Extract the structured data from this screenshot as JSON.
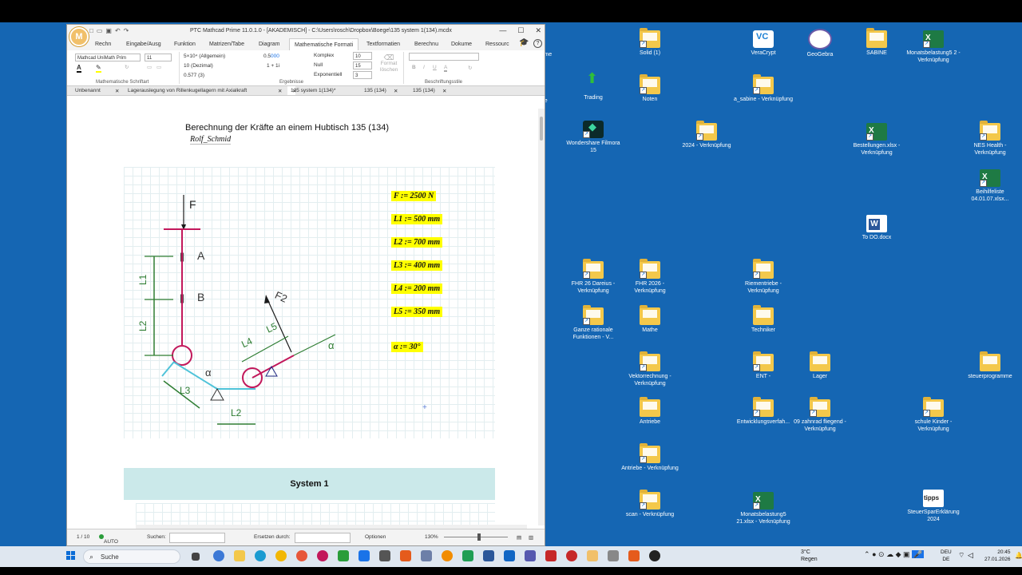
{
  "window": {
    "title": "PTC Mathcad Prime 11.0.1.0 - [AKADEMISCH] - C:\\Users\\rosch\\Dropbox\\Boege\\135 system 1(134).mcdx",
    "logo_letter": "M",
    "minimize": "—",
    "maximize": "☐",
    "close": "✕",
    "help": "?"
  },
  "ribbon_tabs": [
    {
      "label": "Rechn"
    },
    {
      "label": "Eingabe/Ausg"
    },
    {
      "label": "Funktion"
    },
    {
      "label": "Matrizen/Tabe"
    },
    {
      "label": "Diagram"
    },
    {
      "label": "Mathematische Formati"
    },
    {
      "label": "Textformatien"
    },
    {
      "label": "Berechnu"
    },
    {
      "label": "Dokume"
    },
    {
      "label": "Ressourc"
    }
  ],
  "ribbon": {
    "font": "Mathcad UniMath Prim",
    "font_size": "11",
    "format_general": "5×10⁴ (Allgemein)",
    "format_decimal": "10 (Dezimal)",
    "format_third": "0.577 (3)",
    "value_a_black": "0.5",
    "value_a_blue": "000",
    "value_b": "1 + 1i",
    "complex_label": "Komplex",
    "complex_value": "10",
    "null_label": "Null",
    "null_value": "15",
    "exp_label": "Exponentiell",
    "exp_value": "3",
    "format_clear": "Format löschen",
    "style_box": "",
    "group_font": "Mathematische Schriftart",
    "group_results": "Ergebnisse",
    "group_labels": "Beschriftungsstile"
  },
  "doc_tabs": [
    {
      "label": "Unbenannt"
    },
    {
      "label": "Lagerauslegung von Rillenkugellagern mit Axialkraft"
    },
    {
      "label": "135 system 1(134)*"
    },
    {
      "label": "135 (134)"
    },
    {
      "label": "135 (134)"
    }
  ],
  "worksheet": {
    "heading": "Berechnung der Kräfte an einem Hubtisch   135 (134)",
    "author": "Rolf_Schmid",
    "definitions": [
      {
        "label": "F := 2500 N"
      },
      {
        "label": "L1 := 500 mm"
      },
      {
        "label": "L2 := 700 mm"
      },
      {
        "label": "L3 := 400 mm"
      },
      {
        "label": "L4 := 200 mm"
      },
      {
        "label": "L5 := 350 mm"
      },
      {
        "label": "α := 30°"
      }
    ],
    "section_title": "System 1"
  },
  "sketch": {
    "labels": {
      "F": "F",
      "A": "A",
      "B": "B",
      "F2": "F2",
      "L1": "L1",
      "L2": "L2",
      "L3": "L3",
      "L4": "L4",
      "L5": "L5",
      "alpha": "α",
      "L2b": "L2"
    },
    "colors": {
      "force": "#1a1a1a",
      "member": "#c2185b",
      "link": "#4fc3d9",
      "dimension": "#2e7d32"
    }
  },
  "status": {
    "page": "1 / 10",
    "mode": "AUTO",
    "search_label": "Suchen:",
    "replace_label": "Ersetzen durch:",
    "options": "Optionen",
    "zoom": "130%"
  },
  "desktop_icons": [
    {
      "label": "Solid (1)",
      "kind": "folder"
    },
    {
      "label": "VeraCrypt",
      "kind": "veracrypt"
    },
    {
      "label": "GeoGebra",
      "kind": "geogebra"
    },
    {
      "label": "SABINE",
      "kind": "folder"
    },
    {
      "label": "Monatsbelastung5 2 - Verknüpfung",
      "kind": "xls"
    },
    {
      "label": "Trading",
      "kind": "trading"
    },
    {
      "label": "Noten",
      "kind": "folder"
    },
    {
      "label": "a_sabine - Verknüpfung",
      "kind": "folder"
    },
    {
      "label": "Wondershare Filmora 15",
      "kind": "filmora"
    },
    {
      "label": "2024 - Verknüpfung",
      "kind": "folder"
    },
    {
      "label": "Bestellungen.xlsx - Verknüpfung",
      "kind": "xls"
    },
    {
      "label": "NES Health - Verknüpfung",
      "kind": "folder"
    },
    {
      "label": "Beihilfeliste 04.01.07.xlsx...",
      "kind": "xls"
    },
    {
      "label": "To DO.docx",
      "kind": "word"
    },
    {
      "label": "FHR 26 Dareius - Verknüpfung",
      "kind": "folder"
    },
    {
      "label": "FHR 2026 - Verknüpfung",
      "kind": "folder"
    },
    {
      "label": "Riementriebe - Verknüpfung",
      "kind": "folder"
    },
    {
      "label": "Ganze rationale Funktionen - V...",
      "kind": "folder"
    },
    {
      "label": "Mathe",
      "kind": "folder"
    },
    {
      "label": "Techniker",
      "kind": "folder"
    },
    {
      "label": "Vektorrechnung - Verknüpfung",
      "kind": "folder"
    },
    {
      "label": "ENT -",
      "kind": "folder"
    },
    {
      "label": "Lager",
      "kind": "folder"
    },
    {
      "label": "steuerprogramme",
      "kind": "folder"
    },
    {
      "label": "Antriebe",
      "kind": "folder"
    },
    {
      "label": "Entwicklungsverfah...",
      "kind": "folder"
    },
    {
      "label": "09 zahnrad fliegend - Verknüpfung",
      "kind": "folder"
    },
    {
      "label": "schule Kinder - Verknüpfung",
      "kind": "folder"
    },
    {
      "label": "Antriebe - Verknüpfung",
      "kind": "folder"
    },
    {
      "label": "scan - Verknüpfung",
      "kind": "folder"
    },
    {
      "label": "Monatsbelastung5 21.xlsx - Verknüpfung",
      "kind": "xls"
    },
    {
      "label": "SteuerSparErklärung 2024",
      "kind": "tipps"
    },
    {
      "label": "Prime",
      "kind": "partial"
    },
    {
      "label": "ke",
      "kind": "partial"
    }
  ],
  "taskbar": {
    "search": "Suche",
    "weather_temp": "3°C",
    "weather_text": "Regen",
    "lang1": "DEU",
    "lang2": "DE",
    "time": "20:45",
    "date": "27.01.2026"
  }
}
